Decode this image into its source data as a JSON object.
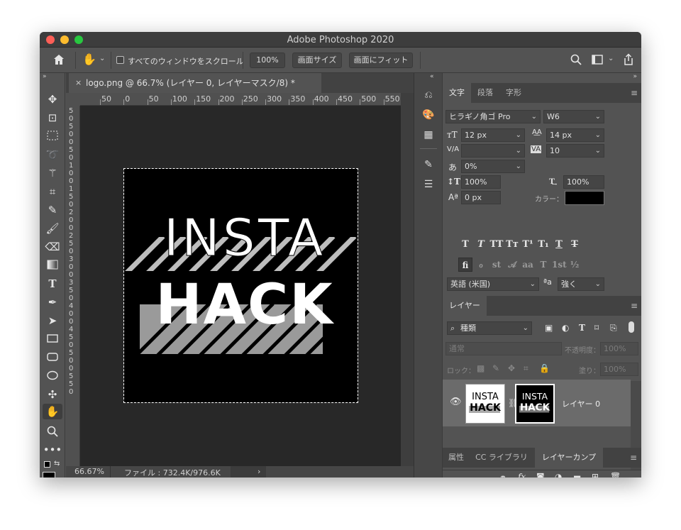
{
  "window": {
    "title": "Adobe Photoshop 2020"
  },
  "options": {
    "scroll_all_label": "すべてのウィンドウをスクロール",
    "zoom_100": "100%",
    "fit_size": "画面サイズ",
    "fit_screen": "画面にフィット"
  },
  "document": {
    "tab_title": "logo.png @ 66.7% (レイヤー 0, レイヤーマスク/8) *",
    "zoom": "66.67%",
    "file_info": "ファイル : 732.4K/976.6K",
    "logo_line1": "INSTA",
    "logo_line2": "HACK",
    "ruler_h": [
      "50",
      "0",
      "50",
      "100",
      "150",
      "200",
      "250",
      "300",
      "350",
      "400",
      "450",
      "500",
      "550"
    ],
    "ruler_v": [
      "5",
      "0",
      "5",
      "0",
      "0",
      "5",
      "0",
      "1",
      "0",
      "0",
      "1",
      "5",
      "0",
      "2",
      "0",
      "0",
      "2",
      "5",
      "0",
      "3",
      "0",
      "0",
      "3",
      "5",
      "0",
      "4",
      "0",
      "0",
      "4",
      "5",
      "0",
      "5",
      "0",
      "0",
      "5",
      "5",
      "0"
    ]
  },
  "character_panel": {
    "tabs": [
      "文字",
      "段落",
      "字形"
    ],
    "font_family": "ヒラギノ角ゴ Pro",
    "font_style": "W6",
    "font_size": "12 px",
    "leading": "14 px",
    "kerning": "",
    "tracking": "10",
    "tsume": "0%",
    "vertical_scale": "100%",
    "horizontal_scale": "100%",
    "baseline_shift": "0 px",
    "color_label": "カラー：",
    "color": "#000000",
    "language": "英語 (米国)",
    "antialias": "強く",
    "style_buttons": [
      "T",
      "T",
      "TT",
      "Tт",
      "T¹",
      "T₁",
      "T",
      "T"
    ],
    "ot_buttons": [
      "fi",
      "ℴ",
      "st",
      "𝒜",
      "aa",
      "T",
      "1st",
      "½"
    ]
  },
  "layers_panel": {
    "title": "レイヤー",
    "filter": "種類",
    "blend_mode": "通常",
    "opacity_label": "不透明度：",
    "opacity": "100%",
    "lock_label": "ロック：",
    "fill_label": "塗り：",
    "fill": "100%",
    "layer_name": "レイヤー 0"
  },
  "bottom_tabs": [
    "属性",
    "CC ライブラリ",
    "レイヤーカンプ"
  ]
}
